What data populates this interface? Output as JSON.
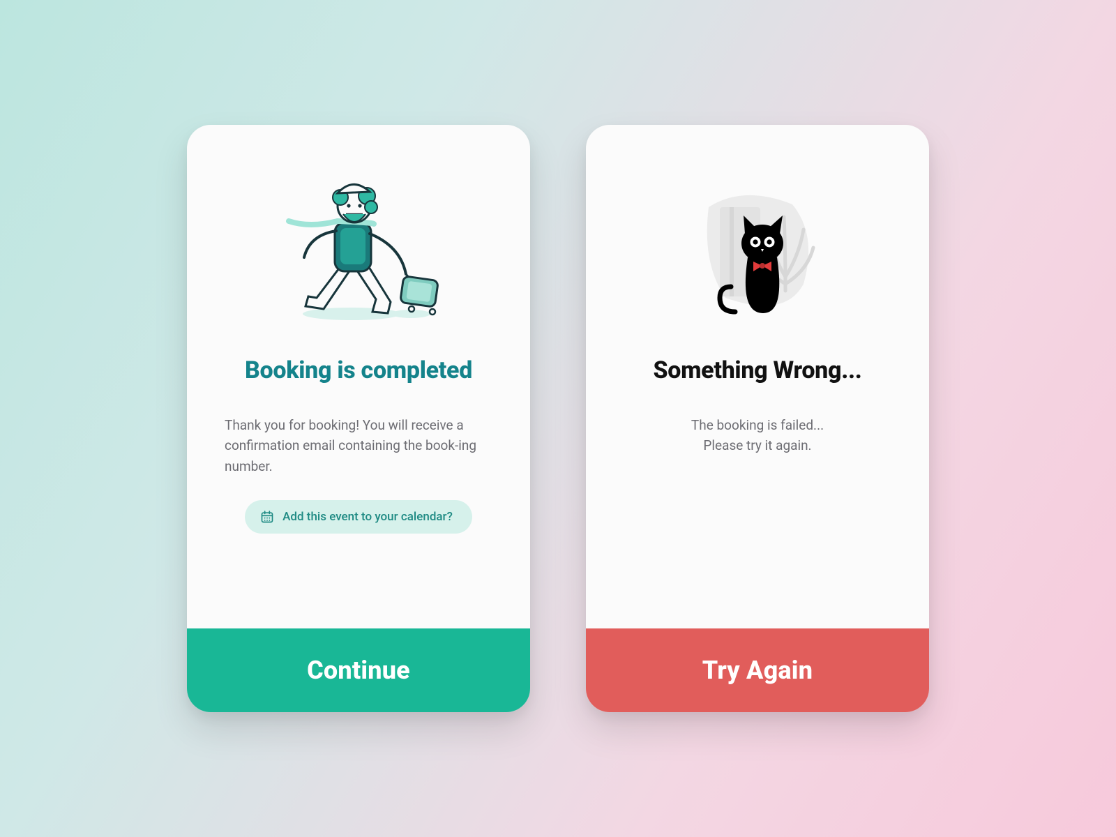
{
  "colors": {
    "success_primary": "#19b796",
    "success_title": "#14838b",
    "error_primary": "#e15d5b",
    "chip_bg": "#d6f1eb"
  },
  "cards": {
    "success": {
      "title": "Booking is completed",
      "description": "Thank you for booking! You will receive a confirmation email containing the book‑ing number.",
      "chip_label": "Add this event to your calendar?",
      "cta_label": "Continue",
      "illustration": "traveler-with-suitcase-icon",
      "chip_icon": "calendar-icon"
    },
    "error": {
      "title": "Something Wrong...",
      "description_line1": "The booking is failed...",
      "description_line2": "Please try it again.",
      "cta_label": "Try Again",
      "illustration": "black-cat-icon"
    }
  }
}
